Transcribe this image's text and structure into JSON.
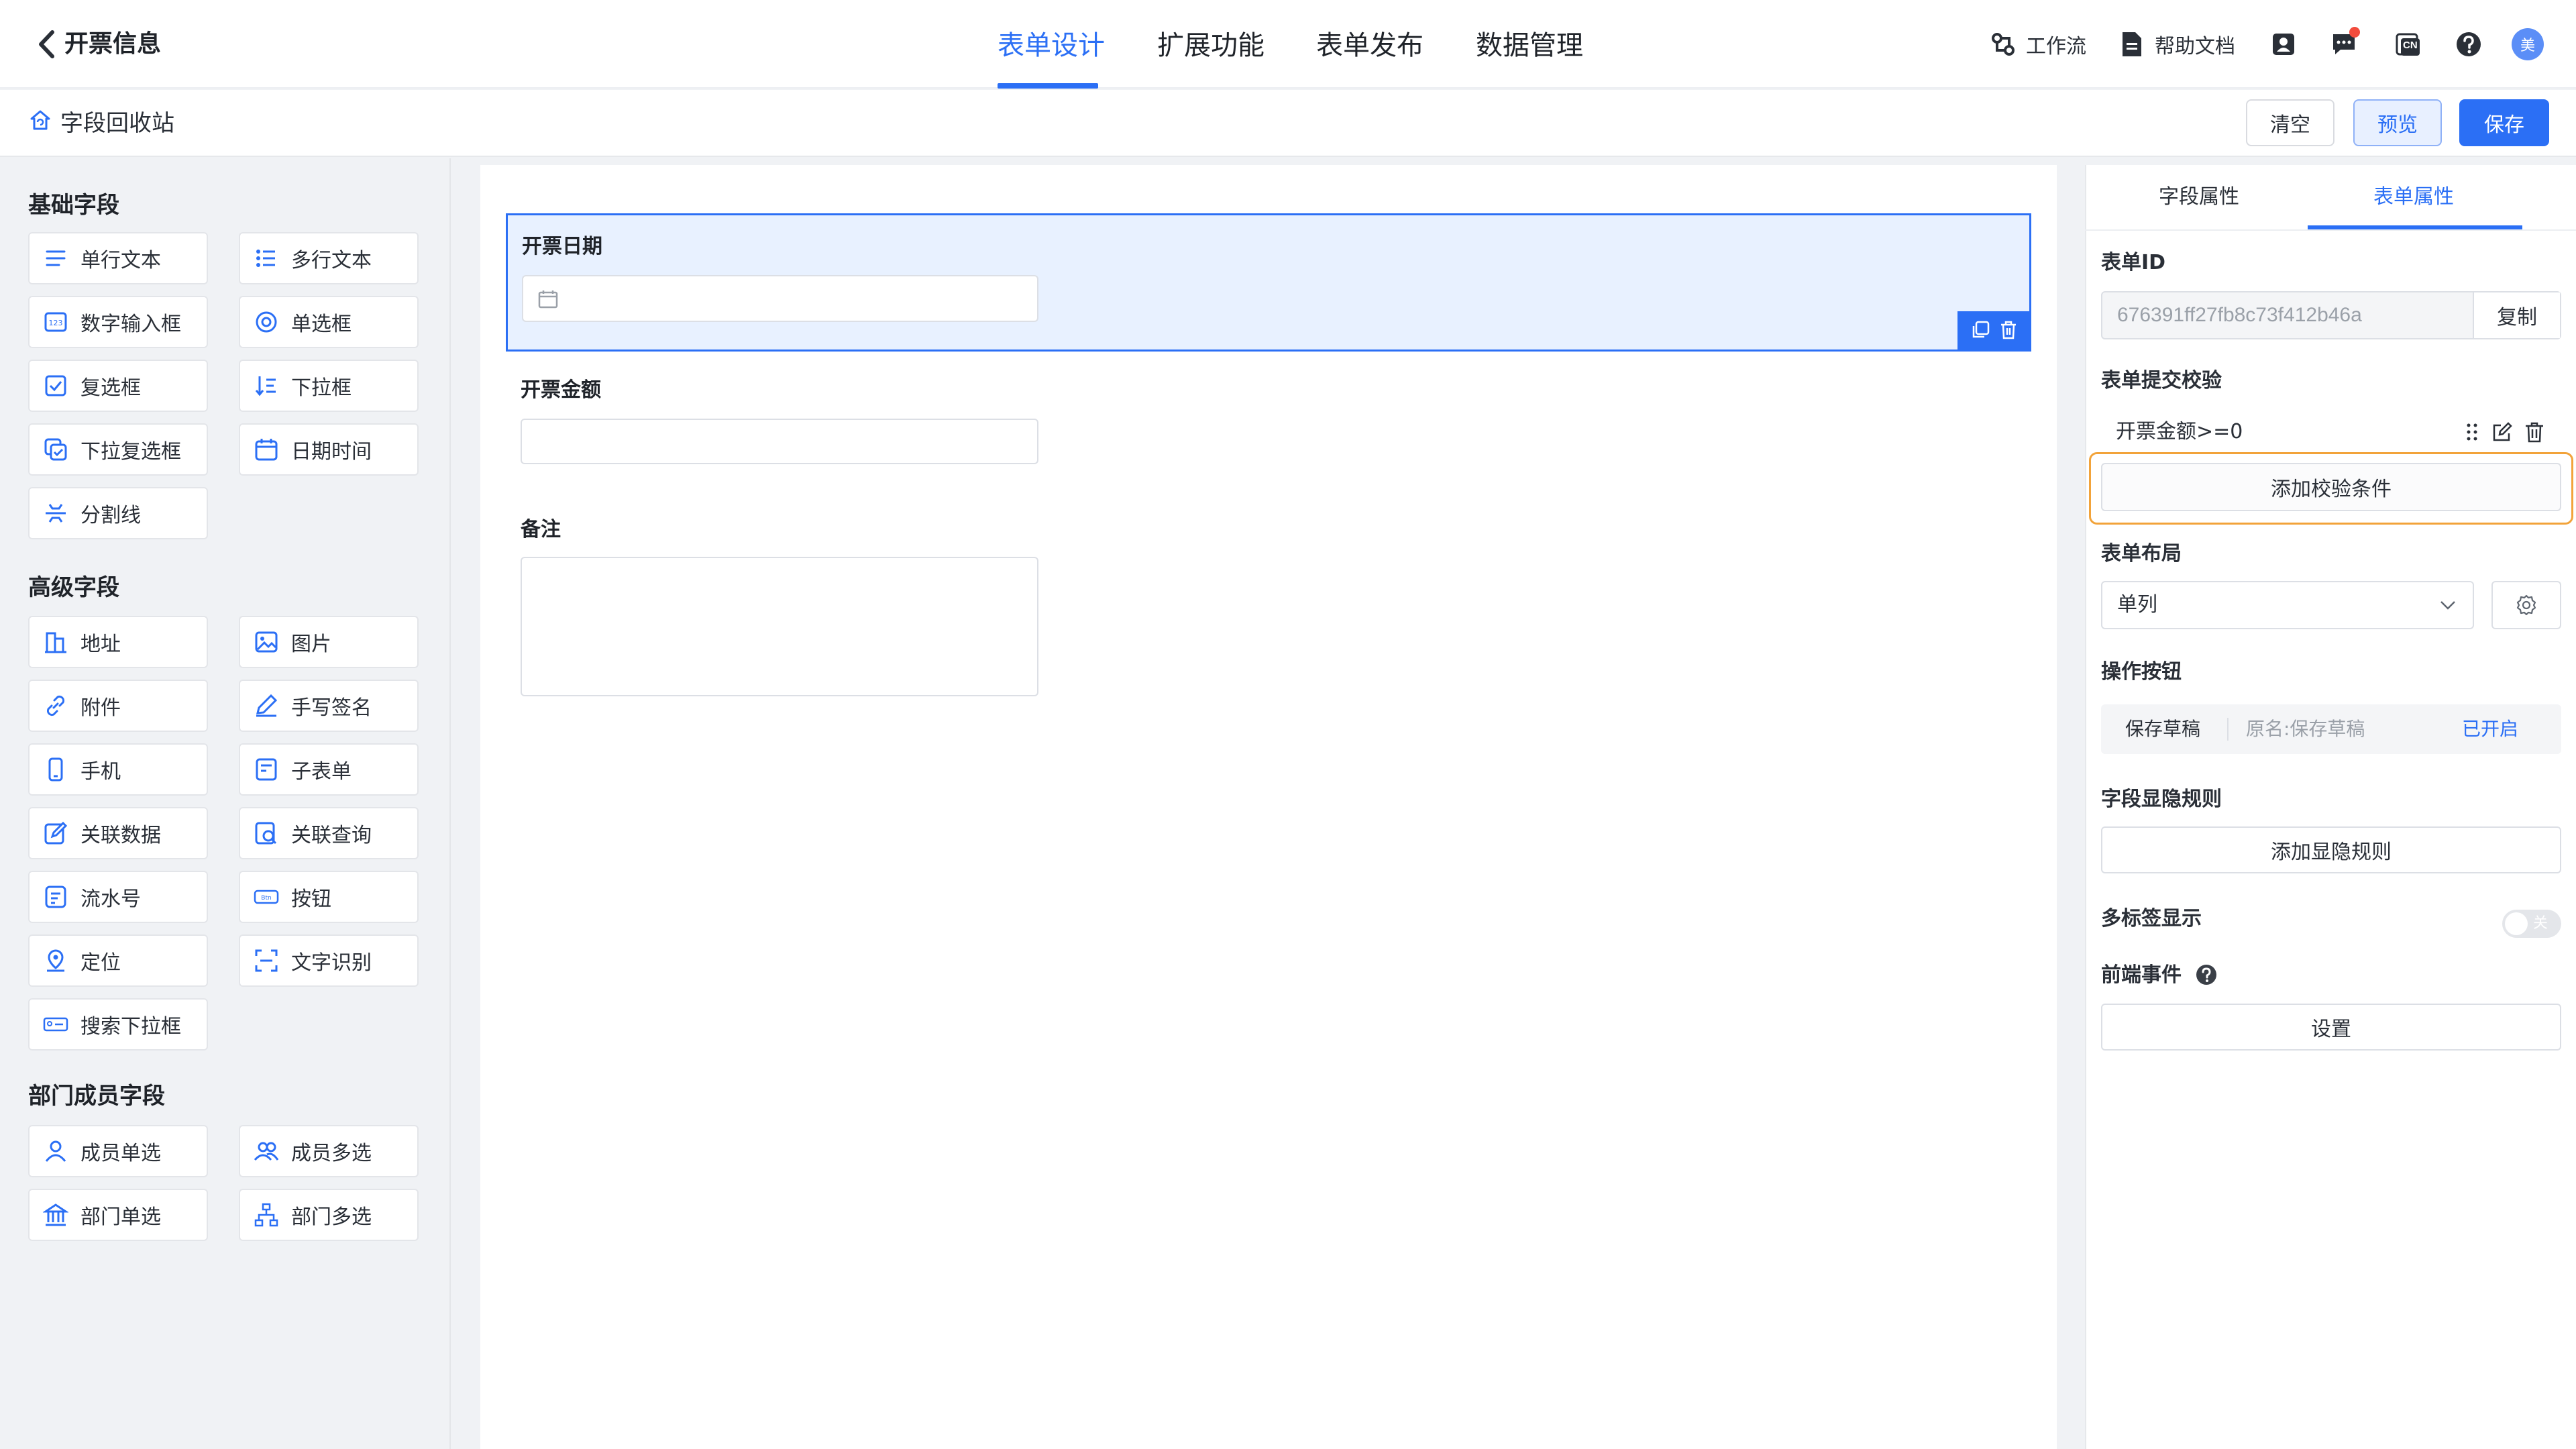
{
  "header": {
    "title": "开票信息",
    "tabs": [
      {
        "label": "表单设计",
        "active": true
      },
      {
        "label": "扩展功能",
        "active": false
      },
      {
        "label": "表单发布",
        "active": false
      },
      {
        "label": "数据管理",
        "active": false
      }
    ],
    "workflow_label": "工作流",
    "help_label": "帮助文档",
    "lang_badge": "CN",
    "avatar_text": "美",
    "accent_color": "#2b6ff5"
  },
  "toolbar": {
    "recycle_label": "字段回收站",
    "clear_label": "清空",
    "preview_label": "预览",
    "save_label": "保存"
  },
  "left": {
    "basic_title": "基础字段",
    "basic": [
      "单行文本",
      "多行文本",
      "数字输入框",
      "单选框",
      "复选框",
      "下拉框",
      "下拉复选框",
      "日期时间",
      "分割线"
    ],
    "advanced_title": "高级字段",
    "advanced": [
      "地址",
      "图片",
      "附件",
      "手写签名",
      "手机",
      "子表单",
      "关联数据",
      "关联查询",
      "流水号",
      "按钮",
      "定位",
      "文字识别",
      "搜索下拉框"
    ],
    "dept_title": "部门成员字段",
    "dept": [
      "成员单选",
      "成员多选",
      "部门单选",
      "部门多选"
    ]
  },
  "canvas": {
    "fields": [
      {
        "label": "开票日期"
      },
      {
        "label": "开票金额"
      },
      {
        "label": "备注"
      }
    ]
  },
  "right": {
    "tabs": [
      {
        "label": "字段属性",
        "active": false
      },
      {
        "label": "表单属性",
        "active": true
      }
    ],
    "form_id_label": "表单ID",
    "form_id_value": "676391ff27fb8c73f412b46a",
    "copy_label": "复制",
    "validation_label": "表单提交校验",
    "validation_rule": "开票金额>=0",
    "add_validation": "添加校验条件",
    "layout_label": "表单布局",
    "layout_value": "单列",
    "action_label": "操作按钮",
    "action_name": "保存草稿",
    "action_original": "原名:保存草稿",
    "action_status": "已开启",
    "visibility_label": "字段显隐规则",
    "add_visibility": "添加显隐规则",
    "multitab_label": "多标签显示",
    "toggle_text": "关",
    "frontend_label": "前端事件",
    "settings_label": "设置"
  }
}
